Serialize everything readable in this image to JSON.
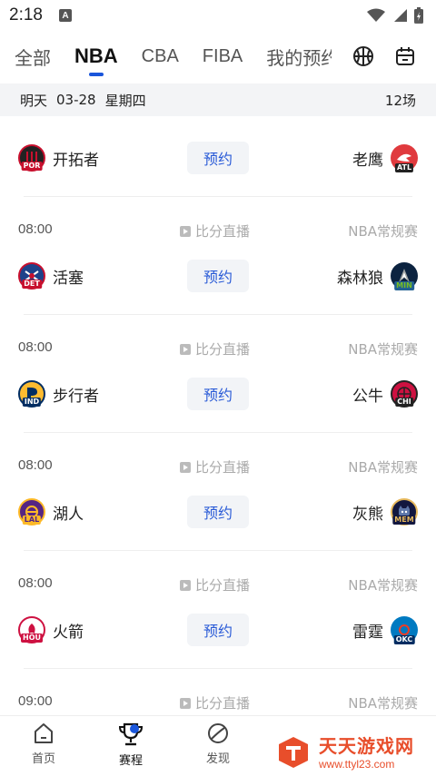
{
  "status_bar": {
    "time": "2:18",
    "badge": "A"
  },
  "tabs": {
    "items": [
      {
        "label": "全部"
      },
      {
        "label": "NBA"
      },
      {
        "label": "CBA"
      },
      {
        "label": "FIBA"
      },
      {
        "label": "我的预约"
      }
    ],
    "active_index": 1
  },
  "date_bar": {
    "day": "明天",
    "date": "03-28",
    "weekday": "星期四",
    "count": "12场"
  },
  "matches": [
    {
      "time": "",
      "live": "",
      "league": "",
      "home": "开拓者",
      "home_abbr": "POR",
      "away": "老鹰",
      "away_abbr": "ATL",
      "reserve": "预约"
    },
    {
      "time": "08:00",
      "live": "比分直播",
      "league": "NBA常规赛",
      "home": "活塞",
      "home_abbr": "DET",
      "away": "森林狼",
      "away_abbr": "MIN",
      "reserve": "预约"
    },
    {
      "time": "08:00",
      "live": "比分直播",
      "league": "NBA常规赛",
      "home": "步行者",
      "home_abbr": "IND",
      "away": "公牛",
      "away_abbr": "CHI",
      "reserve": "预约"
    },
    {
      "time": "08:00",
      "live": "比分直播",
      "league": "NBA常规赛",
      "home": "湖人",
      "home_abbr": "LAL",
      "away": "灰熊",
      "away_abbr": "MEM",
      "reserve": "预约"
    },
    {
      "time": "08:00",
      "live": "比分直播",
      "league": "NBA常规赛",
      "home": "火箭",
      "home_abbr": "HOU",
      "away": "雷霆",
      "away_abbr": "OKC",
      "reserve": "预约"
    },
    {
      "time": "09:00",
      "live": "比分直播",
      "league": "NBA常规赛"
    }
  ],
  "bottom_nav": [
    {
      "label": "首页",
      "icon": "home-icon"
    },
    {
      "label": "赛程",
      "icon": "trophy-icon"
    },
    {
      "label": "发现",
      "icon": "discover-icon"
    }
  ],
  "watermark": {
    "title": "天天游戏网",
    "url": "www.ttyl23.com"
  },
  "colors": {
    "accent": "#1a56db",
    "reserve_text": "#2a5bd7",
    "date_bar_bg": "#f3f4f6",
    "watermark": "#e84e2b"
  }
}
